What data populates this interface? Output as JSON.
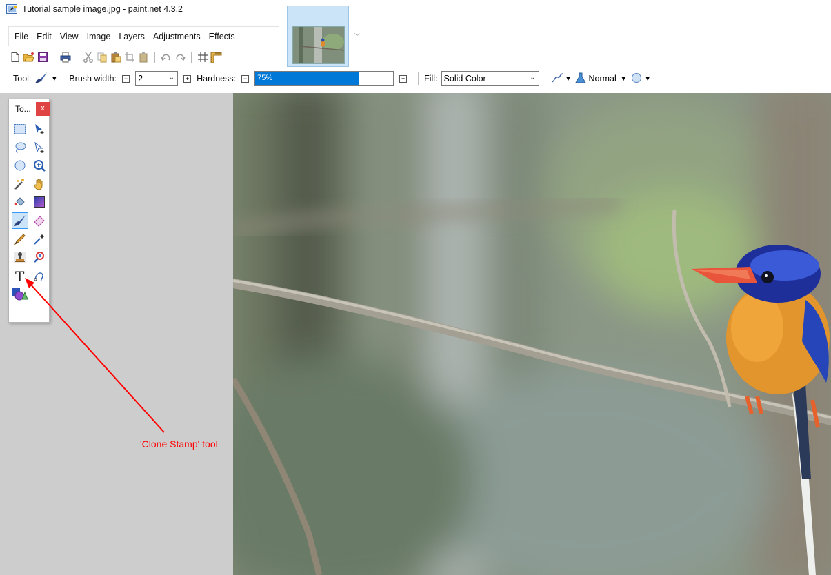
{
  "window": {
    "title": "Tutorial sample image.jpg - paint.net 4.3.2",
    "app_icon": "paintnet-icon"
  },
  "menu": {
    "items": [
      "File",
      "Edit",
      "View",
      "Image",
      "Layers",
      "Adjustments",
      "Effects"
    ]
  },
  "quick_toolbar": {
    "icons": [
      "new-file-icon",
      "open-file-icon",
      "save-icon",
      "print-icon",
      "cut-icon",
      "copy-icon",
      "paste-icon",
      "crop-icon",
      "paste-new-layer-icon",
      "undo-icon",
      "redo-icon",
      "grid-icon",
      "ruler-icon"
    ]
  },
  "tool_options": {
    "tool_label": "Tool:",
    "brush_width_label": "Brush width:",
    "brush_width_value": "2",
    "hardness_label": "Hardness:",
    "hardness_value": "75%",
    "hardness_fraction": 0.75,
    "fill_label": "Fill:",
    "fill_value": "Solid Color",
    "blend_mode": "Normal"
  },
  "tools_window": {
    "title": "To...",
    "close_label": "x",
    "tools": [
      {
        "name": "rectangle-select-icon",
        "selected": false
      },
      {
        "name": "move-selected-pixels-icon",
        "selected": false
      },
      {
        "name": "lasso-select-icon",
        "selected": false
      },
      {
        "name": "move-selection-icon",
        "selected": false
      },
      {
        "name": "ellipse-select-icon",
        "selected": false
      },
      {
        "name": "zoom-icon",
        "selected": false
      },
      {
        "name": "magic-wand-icon",
        "selected": false
      },
      {
        "name": "pan-icon",
        "selected": false
      },
      {
        "name": "paint-bucket-icon",
        "selected": false
      },
      {
        "name": "gradient-icon",
        "selected": false
      },
      {
        "name": "paintbrush-icon",
        "selected": true
      },
      {
        "name": "eraser-icon",
        "selected": false
      },
      {
        "name": "pencil-icon",
        "selected": false
      },
      {
        "name": "color-picker-icon",
        "selected": false
      },
      {
        "name": "clone-stamp-icon",
        "selected": false
      },
      {
        "name": "recolor-icon",
        "selected": false
      },
      {
        "name": "text-icon",
        "selected": false
      },
      {
        "name": "line-curve-icon",
        "selected": false
      },
      {
        "name": "shapes-icon",
        "selected": false
      }
    ]
  },
  "annotation": {
    "label": "'Clone Stamp' tool",
    "color": "#ff0000"
  },
  "colors": {
    "accent": "#0078d7",
    "selection": "#cce4f7",
    "workspace": "#cdcdcd",
    "close": "#e04343"
  }
}
